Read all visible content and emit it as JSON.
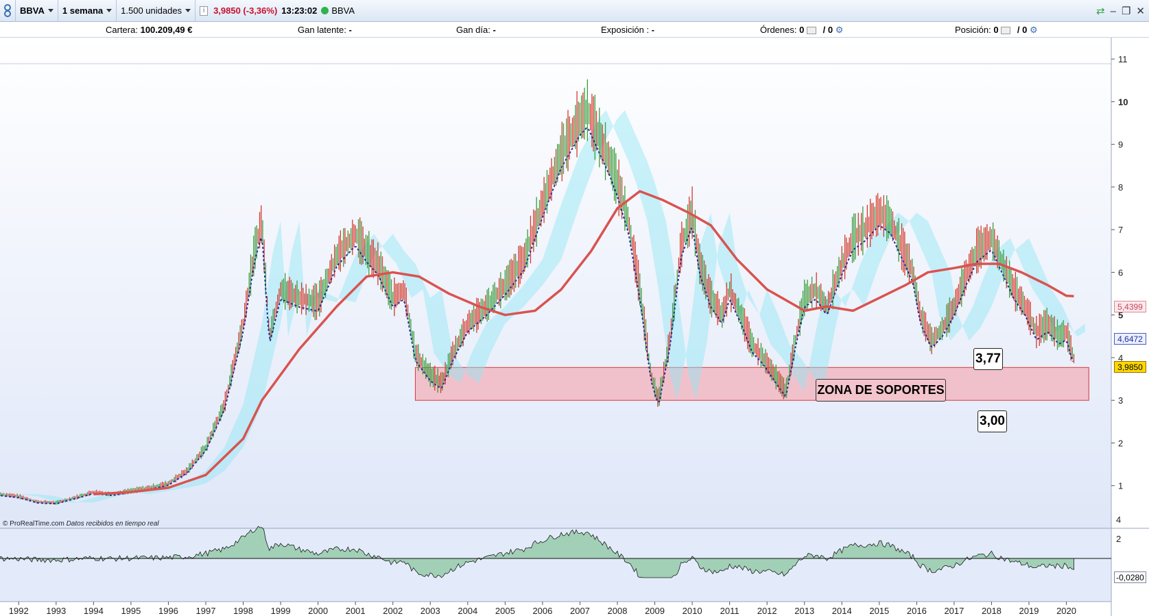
{
  "toolbar": {
    "symbol": "BBVA",
    "timeframe": "1 semana",
    "units": "1.500 unidades",
    "price": "3,9850 (-3,36%)",
    "time": "13:23:02",
    "instrument": "BBVA"
  },
  "info_bar": {
    "cartera_label": "Cartera:",
    "cartera_value": "100.209,49 €",
    "gan_latente_label": "Gan latente:",
    "gan_latente_value": "-",
    "gan_dia_label": "Gan día:",
    "gan_dia_value": "-",
    "exposicion_label": "Exposición :",
    "exposicion_value": "-",
    "ordenes_label": "Órdenes:",
    "ordenes_value_1": "0",
    "ordenes_value_2": "/ 0",
    "posicion_label": "Posición:",
    "posicion_value_1": "0",
    "posicion_value_2": "/ 0"
  },
  "credit": {
    "site": "© ProRealTime.com",
    "note": "Datos recibidos en tiempo real"
  },
  "annotations": {
    "zona_label": "ZONA DE SOPORTES",
    "upper_value": "3,77",
    "lower_value": "3,00"
  },
  "tags": {
    "sma_value": "5,4399",
    "tenkan_value": "4,6472",
    "last_price": "3,9850",
    "oscillator_value": "-0,0280"
  },
  "colors": {
    "sma": "#d9534f",
    "tenkan": "#1f2f9a",
    "candles_up": "#3a9b3a",
    "candles_down": "#d23a2a",
    "cloud_bull": "#9fe3a7",
    "cloud_bear": "#8fe7f4",
    "support_zone": "#f2b8c2",
    "osc_pos": "#8cc7a0",
    "osc_neg": "#c8a2ad"
  },
  "chart_data": {
    "type": "line",
    "title": "",
    "xlabel": "",
    "ylabel": "",
    "ylim": [
      0,
      11.5
    ],
    "xlim": [
      1991.5,
      2021.2
    ],
    "y_ticks": [
      1,
      2,
      3,
      4,
      5,
      6,
      7,
      8,
      9,
      10,
      11
    ],
    "x_ticks": [
      "1992",
      "1993",
      "1994",
      "1995",
      "1996",
      "1997",
      "1998",
      "1999",
      "2000",
      "2001",
      "2002",
      "2003",
      "2004",
      "2005",
      "2006",
      "2007",
      "2008",
      "2009",
      "2010",
      "2011",
      "2012",
      "2013",
      "2014",
      "2015",
      "2016",
      "2017",
      "2018",
      "2019",
      "2020"
    ],
    "support_zone": {
      "low": 3.0,
      "high": 3.77,
      "x_start": 2002.6,
      "x_end": 2020.6
    },
    "series": [
      {
        "name": "",
        "x": [
          1991.5,
          1992.0,
          1992.5,
          1993.0,
          1993.5,
          1994.0,
          1994.5,
          1995.0,
          1995.5,
          1996.0,
          1996.5,
          1997.0,
          1997.5,
          1998.0,
          1998.3,
          1998.5,
          1998.7,
          1999.0,
          1999.5,
          2000.0,
          2000.5,
          2001.0,
          2001.3,
          2001.6,
          2002.0,
          2002.3,
          2002.6,
          2003.0,
          2003.3,
          2003.6,
          2004.0,
          2004.5,
          2005.0,
          2005.5,
          2006.0,
          2006.5,
          2007.0,
          2007.2,
          2007.5,
          2007.8,
          2008.0,
          2008.3,
          2008.6,
          2008.9,
          2009.1,
          2009.4,
          2009.7,
          2010.0,
          2010.2,
          2010.5,
          2010.8,
          2011.0,
          2011.3,
          2011.6,
          2011.9,
          2012.2,
          2012.5,
          2012.8,
          2013.0,
          2013.3,
          2013.6,
          2014.0,
          2014.3,
          2014.6,
          2015.0,
          2015.3,
          2015.6,
          2015.9,
          2016.1,
          2016.4,
          2016.7,
          2017.0,
          2017.3,
          2017.6,
          2018.0,
          2018.3,
          2018.6,
          2018.9,
          2019.2,
          2019.5,
          2019.8,
          2020.0,
          2020.2
        ],
        "y": [
          0.8,
          0.75,
          0.62,
          0.6,
          0.72,
          0.85,
          0.8,
          0.88,
          0.95,
          1.05,
          1.35,
          1.9,
          2.9,
          4.8,
          6.5,
          7.2,
          4.5,
          5.6,
          5.4,
          5.3,
          6.4,
          6.9,
          6.5,
          6.2,
          5.4,
          5.6,
          4.1,
          3.6,
          3.4,
          4.1,
          4.8,
          5.2,
          5.7,
          6.3,
          7.6,
          8.8,
          9.6,
          9.8,
          9.2,
          8.6,
          8.1,
          7.2,
          5.6,
          3.6,
          3.0,
          4.4,
          6.6,
          7.4,
          6.2,
          5.4,
          5.0,
          5.6,
          5.0,
          4.3,
          4.0,
          3.6,
          3.2,
          4.6,
          5.4,
          5.6,
          5.2,
          6.2,
          6.8,
          7.0,
          7.4,
          7.2,
          6.6,
          6.0,
          5.0,
          4.4,
          4.7,
          5.2,
          5.9,
          6.5,
          6.8,
          6.2,
          5.6,
          5.2,
          4.6,
          4.8,
          4.5,
          4.6,
          3.98
        ]
      },
      {
        "name": "",
        "x": [
          1994.0,
          1995.0,
          1996.0,
          1997.0,
          1998.0,
          1998.5,
          1999.5,
          2000.5,
          2001.3,
          2002.0,
          2002.7,
          2003.5,
          2004.3,
          2005.0,
          2005.8,
          2006.5,
          2007.3,
          2008.0,
          2008.6,
          2009.2,
          2009.9,
          2010.5,
          2011.2,
          2012.0,
          2012.6,
          2013.0,
          2013.6,
          2014.3,
          2015.0,
          2015.7,
          2016.3,
          2017.0,
          2017.6,
          2018.2,
          2018.8,
          2019.5,
          2020.0,
          2020.2
        ],
        "y": [
          0.8,
          0.85,
          0.95,
          1.25,
          2.1,
          3.0,
          4.2,
          5.2,
          5.9,
          6.0,
          5.9,
          5.5,
          5.2,
          5.0,
          5.1,
          5.6,
          6.5,
          7.5,
          7.9,
          7.7,
          7.4,
          7.1,
          6.3,
          5.6,
          5.3,
          5.1,
          5.2,
          5.1,
          5.4,
          5.7,
          6.0,
          6.1,
          6.2,
          6.2,
          6.0,
          5.7,
          5.45,
          5.44
        ]
      }
    ]
  }
}
